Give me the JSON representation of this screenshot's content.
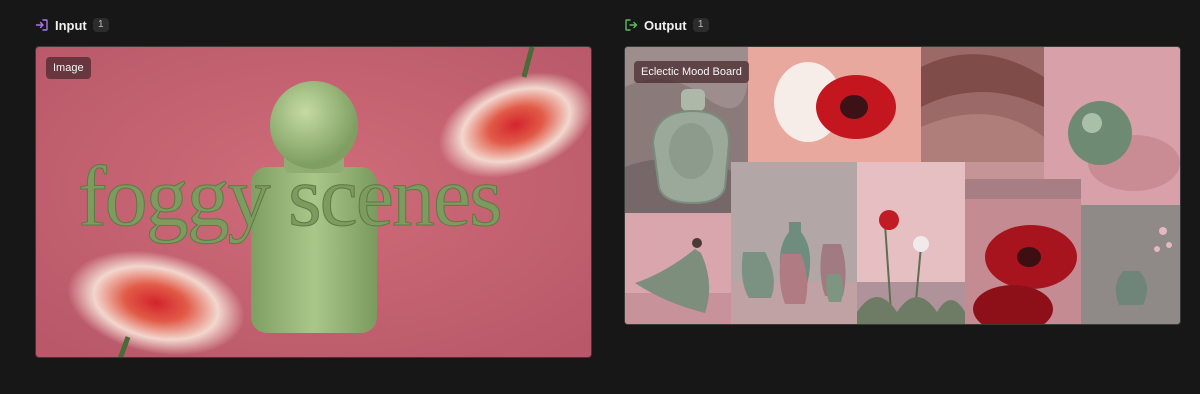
{
  "input_panel": {
    "label": "Input",
    "count": "1",
    "badge": "Image",
    "headline": "foggy scenes",
    "icon": "arrow-into-box-icon",
    "colors": {
      "icon": "#a778e6",
      "background": "#c85f6e"
    }
  },
  "output_panel": {
    "label": "Output",
    "count": "1",
    "badge": "Eclectic Mood Board",
    "icon": "arrow-out-of-box-icon",
    "colors": {
      "icon": "#5dbb63"
    }
  }
}
